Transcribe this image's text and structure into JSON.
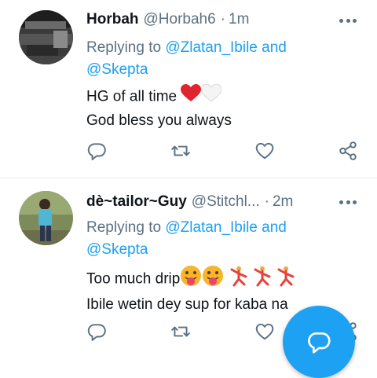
{
  "tweets": [
    {
      "display_name": "Horbah",
      "handle": "@Horbah6",
      "separator": "·",
      "time": "1m",
      "replying_prefix": "Replying to",
      "replying_user1": "@Zlatan_Ibile",
      "replying_and": "and",
      "replying_user2": "@Skepta",
      "text_line1": "HG of all time",
      "text_line2": "God bless you always",
      "emojis": [
        "red-heart",
        "white-heart"
      ]
    },
    {
      "display_name": "dè~tailor~Guy",
      "handle": "@Stitchl...",
      "separator": "·",
      "time": "2m",
      "replying_prefix": "Replying to",
      "replying_user1": "@Zlatan_Ibile",
      "replying_and": "and",
      "replying_user2": "@Skepta",
      "text_line1": "Too much drip",
      "text_line2": "Ibile wetin dey sup for kaba na",
      "emojis": [
        "tongue-face",
        "tongue-face",
        "dancer",
        "dancer",
        "dancer"
      ]
    }
  ],
  "colors": {
    "accent": "#1da1f2",
    "secondary_text": "#5b7083",
    "primary_text": "#0f1419",
    "divider": "#e6ecf0"
  },
  "icons": {
    "reply": "reply-icon",
    "retweet": "retweet-icon",
    "like": "like-icon",
    "share": "share-icon",
    "more": "more-icon",
    "compose": "compose-icon"
  }
}
